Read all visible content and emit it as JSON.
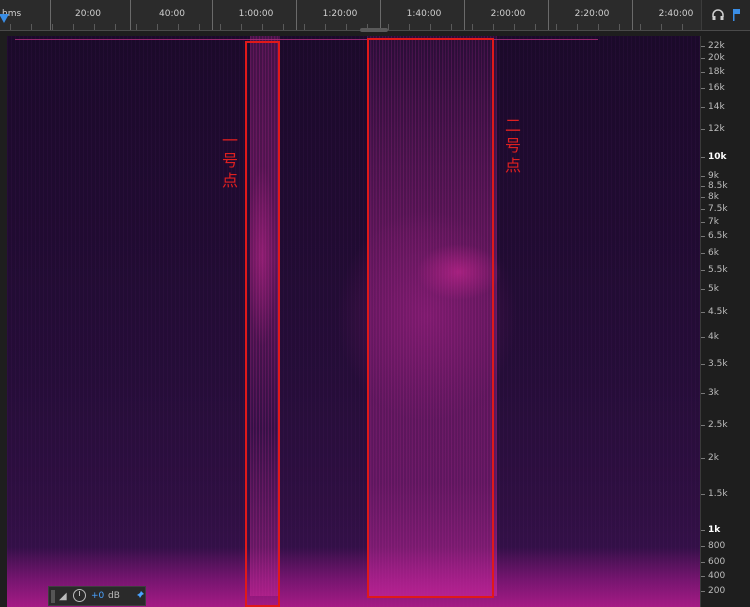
{
  "timeline": {
    "unit_label": "hms",
    "time_labels": [
      "20:00",
      "40:00",
      "1:00:00",
      "1:20:00",
      "1:40:00",
      "2:00:00",
      "2:20:00",
      "2:40:00"
    ],
    "playhead_color": "#3a8ee6"
  },
  "toolbar_icons": [
    "headphones-icon",
    "marker-icon"
  ],
  "spectrogram": {
    "colors": {
      "background": "#1b0a2a",
      "energy": "#c0248a",
      "annotation": "#e01919"
    },
    "annotations": [
      {
        "label_chars": [
          "一",
          "号",
          "点"
        ]
      },
      {
        "label_chars": [
          "二",
          "号",
          "点"
        ]
      }
    ]
  },
  "frequency_axis": {
    "labels": [
      "22k",
      "20k",
      "18k",
      "16k",
      "14k",
      "12k",
      "10k",
      "9k",
      "8.5k",
      "8k",
      "7.5k",
      "7k",
      "6.5k",
      "6k",
      "5.5k",
      "5k",
      "4.5k",
      "4k",
      "3.5k",
      "3k",
      "2.5k",
      "2k",
      "1.5k",
      "1k",
      "800",
      "600",
      "400",
      "200"
    ],
    "bold_labels": [
      "10k",
      "1k"
    ]
  },
  "hud": {
    "gain_value": "+0",
    "gain_unit": "dB"
  }
}
